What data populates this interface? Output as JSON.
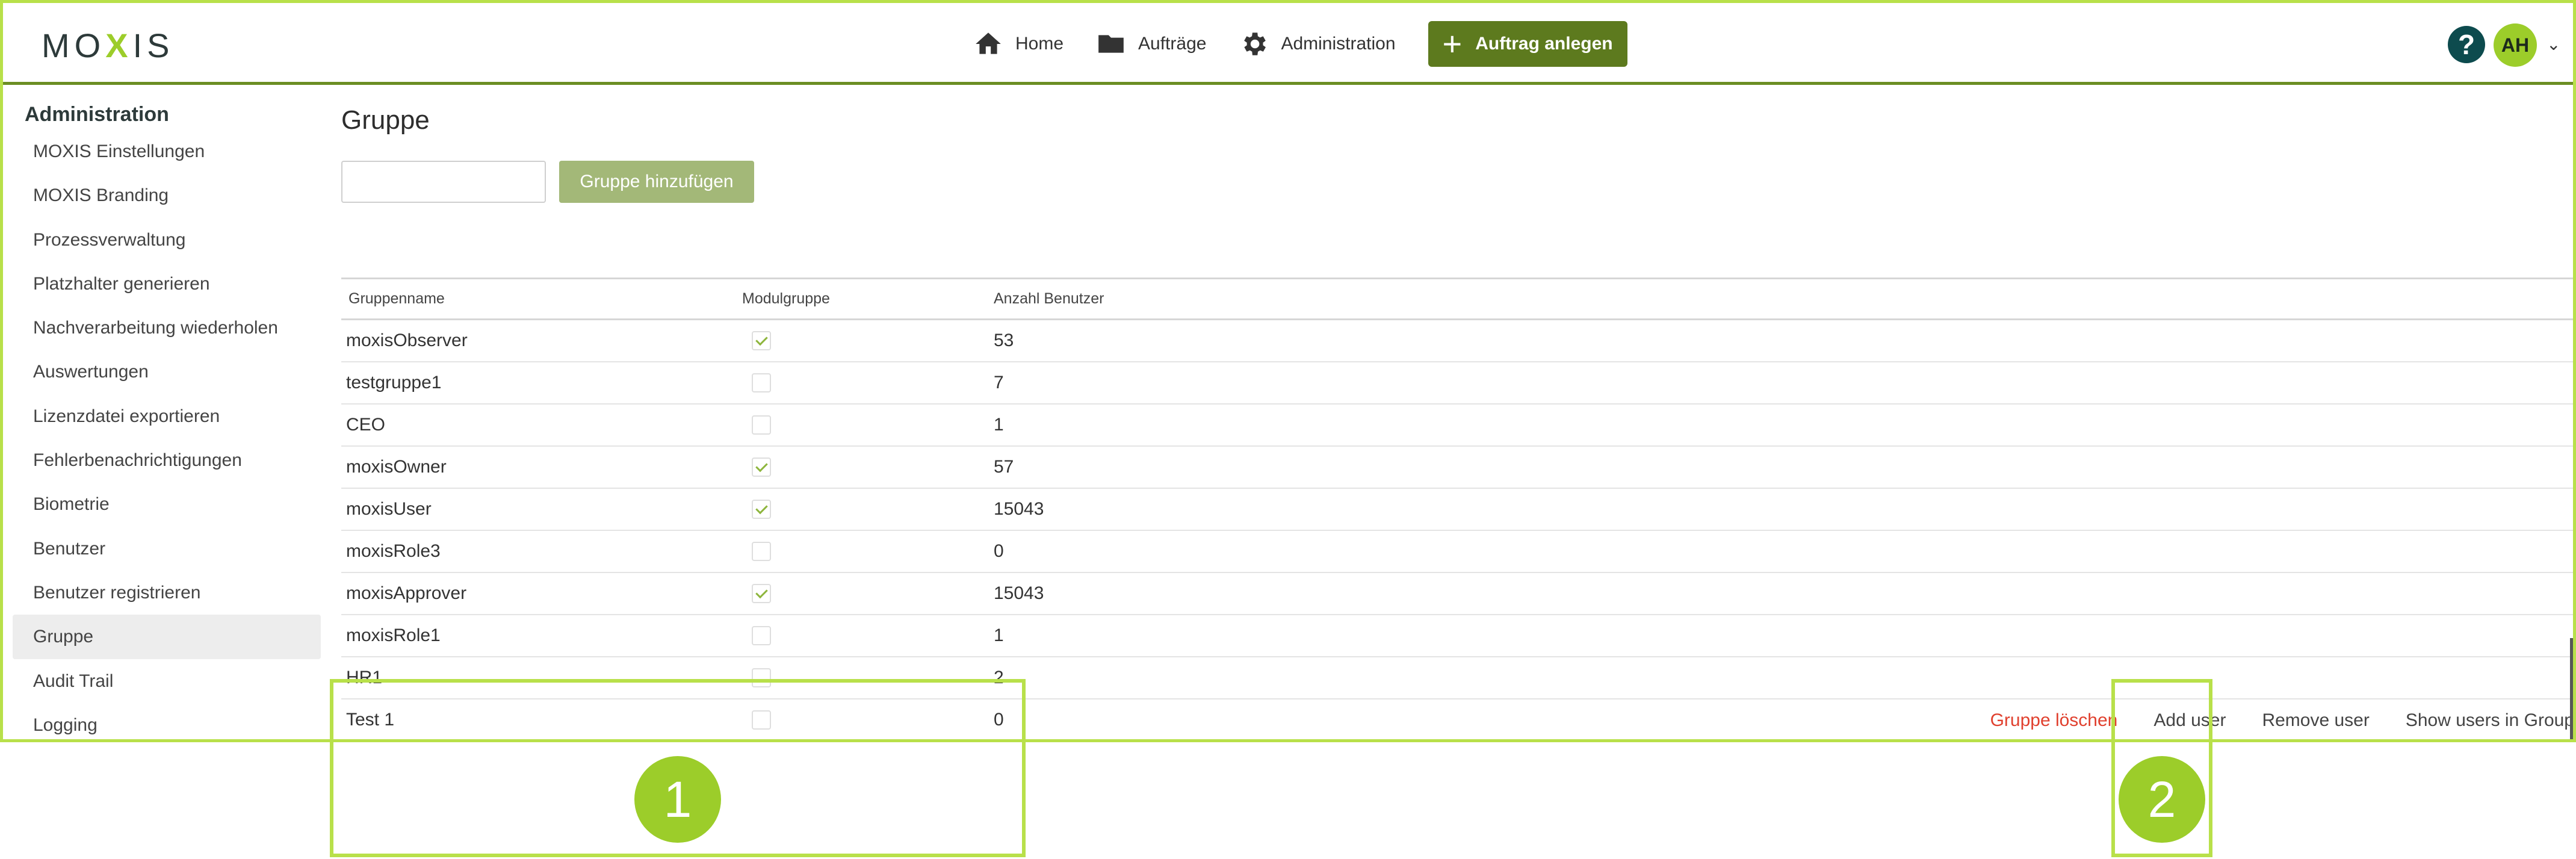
{
  "header": {
    "logo": "MOXIS",
    "nav": [
      {
        "label": "Home",
        "icon": "home-icon"
      },
      {
        "label": "Aufträge",
        "icon": "folder-icon"
      },
      {
        "label": "Administration",
        "icon": "gear-icon"
      }
    ],
    "create_order_label": "Auftrag anlegen",
    "help_label": "?",
    "avatar_initials": "AH"
  },
  "sidebar": {
    "title": "Administration",
    "items": [
      {
        "label": "MOXIS Einstellungen"
      },
      {
        "label": "MOXIS Branding"
      },
      {
        "label": "Prozessverwaltung"
      },
      {
        "label": "Platzhalter generieren"
      },
      {
        "label": "Nachverarbeitung wiederholen"
      },
      {
        "label": "Auswertungen"
      },
      {
        "label": "Lizenzdatei exportieren"
      },
      {
        "label": "Fehlerbenachrichtigungen"
      },
      {
        "label": "Biometrie"
      },
      {
        "label": "Benutzer"
      },
      {
        "label": "Benutzer registrieren"
      },
      {
        "label": "Gruppe",
        "active": true
      },
      {
        "label": "Audit Trail"
      },
      {
        "label": "Logging"
      }
    ]
  },
  "main": {
    "title": "Gruppe",
    "group_input_value": "",
    "add_group_label": "Gruppe hinzufügen",
    "table": {
      "headers": [
        "Gruppenname",
        "Modulgruppe",
        "Anzahl Benutzer"
      ],
      "rows": [
        {
          "name": "moxisObserver",
          "module": true,
          "count": "53"
        },
        {
          "name": "testgruppe1",
          "module": false,
          "count": "7"
        },
        {
          "name": "CEO",
          "module": false,
          "count": "1"
        },
        {
          "name": "moxisOwner",
          "module": true,
          "count": "57"
        },
        {
          "name": "moxisUser",
          "module": true,
          "count": "15043"
        },
        {
          "name": "moxisRole3",
          "module": false,
          "count": "0"
        },
        {
          "name": "moxisApprover",
          "module": true,
          "count": "15043"
        },
        {
          "name": "moxisRole1",
          "module": false,
          "count": "1"
        },
        {
          "name": "HR1",
          "module": false,
          "count": "2"
        },
        {
          "name": "Test 1",
          "module": false,
          "count": "0"
        }
      ]
    },
    "row_actions": {
      "delete_label": "Gruppe löschen",
      "add_user_label": "Add user",
      "remove_user_label": "Remove user",
      "show_users_label": "Show users in Group"
    }
  },
  "callouts": [
    {
      "number": "1"
    },
    {
      "number": "2"
    }
  ],
  "colors": {
    "accent_lime": "#9ccd2a",
    "primary_green": "#5d7a1e",
    "danger_red": "#e0402e"
  }
}
